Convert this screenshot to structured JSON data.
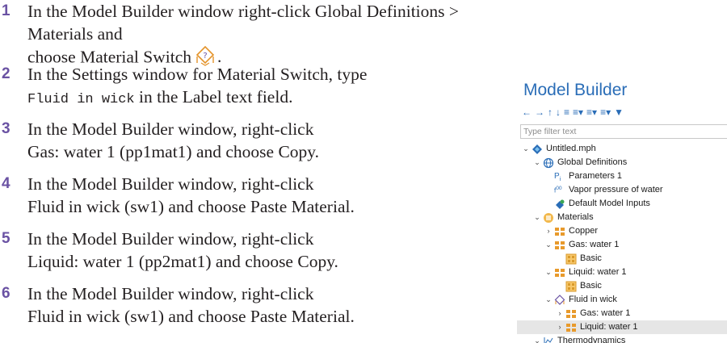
{
  "steps": [
    {
      "num": "1",
      "parts": [
        "In the Model Builder window right-click Global Definitions > Materials and",
        "choose Material Switch"
      ]
    },
    {
      "num": "2",
      "parts": [
        "In the Settings window for Material Switch, type",
        "Fluid in wick",
        " in the Label text field."
      ]
    },
    {
      "num": "3",
      "parts": [
        "In the Model Builder window, right-click",
        "Gas: water 1 (pp1mat1) and choose Copy."
      ]
    },
    {
      "num": "4",
      "parts": [
        "In the Model Builder window, right-click",
        "Fluid in wick (sw1) and choose Paste Material."
      ]
    },
    {
      "num": "5",
      "parts": [
        "In the Model Builder window, right-click",
        "Liquid: water 1 (pp2mat1) and choose Copy."
      ]
    },
    {
      "num": "6",
      "parts": [
        "In the Model Builder window, right-click",
        "Fluid in wick (sw1) and choose Paste Material."
      ]
    }
  ],
  "panel": {
    "title": "Model Builder",
    "filter_placeholder": "Type filter text",
    "tree": [
      {
        "label": "Untitled.mph",
        "icon": "model-file-icon"
      },
      {
        "label": "Global Definitions",
        "icon": "globe-icon"
      },
      {
        "label": "Parameters 1",
        "icon": "parameters-icon"
      },
      {
        "label": "Vapor pressure of water",
        "icon": "function-icon"
      },
      {
        "label": "Default Model Inputs",
        "icon": "model-inputs-icon"
      },
      {
        "label": "Materials",
        "icon": "materials-folder-icon"
      },
      {
        "label": "Copper",
        "icon": "material-icon"
      },
      {
        "label": "Gas: water 1",
        "icon": "material-icon"
      },
      {
        "label": "Basic",
        "icon": "property-group-icon"
      },
      {
        "label": "Liquid: water 1",
        "icon": "material-icon"
      },
      {
        "label": "Basic",
        "icon": "property-group-icon"
      },
      {
        "label": "Fluid in wick",
        "icon": "material-switch-icon"
      },
      {
        "label": "Gas: water 1",
        "icon": "material-icon"
      },
      {
        "label": "Liquid: water 1",
        "icon": "material-icon"
      },
      {
        "label": "Thermodynamics",
        "icon": "thermodynamics-icon"
      }
    ]
  },
  "colors": {
    "step_number": "#6a52a3",
    "panel_title": "#2a6db7",
    "selected_row": "#e6e6e6"
  }
}
